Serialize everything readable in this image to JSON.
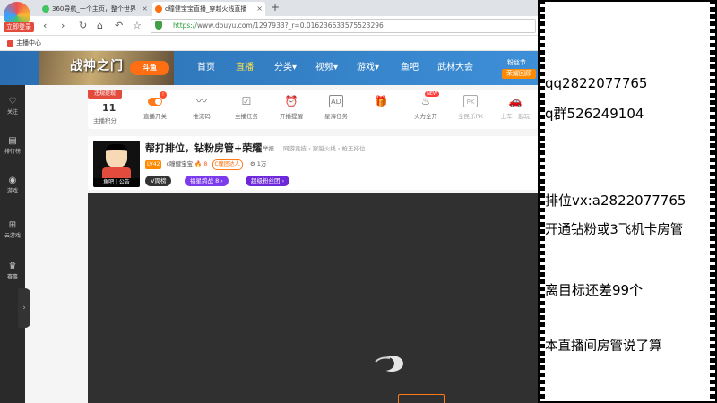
{
  "browser": {
    "tabs": [
      {
        "label": "360导航_一个主页，整个世界",
        "color": "#43c463"
      },
      {
        "label": "c瞳健宝宝直播_穿越火线直播",
        "color": "#ff6e13"
      }
    ],
    "new_tab": "+",
    "login_badge": "立即登录",
    "url_https": "https://",
    "url_rest": "www.douyu.com/1297933?_r=0.016236633575523296",
    "nav": {
      "back": "‹",
      "forward": "›",
      "reload": "↻",
      "home": "⌂",
      "undo": "↶",
      "star": "☆"
    },
    "bookmark": "主播中心"
  },
  "header": {
    "banner_text": "战神之门",
    "logo_text": "斗鱼",
    "nav_items": [
      "首页",
      "直播",
      "分类▾",
      "视频▾",
      "游戏▾",
      "鱼吧",
      "武林大会"
    ],
    "active_index": 1,
    "follow_label": "粉丝节",
    "honor_label": "荣耀回顾"
  },
  "sidebar": {
    "items": [
      {
        "icon": "♡",
        "label": "关注"
      },
      {
        "icon": "▤",
        "label": "排行榜"
      },
      {
        "icon": "◉",
        "label": "游戏"
      },
      {
        "icon": "⊞",
        "label": "云游戏"
      },
      {
        "icon": "♛",
        "label": "赛事"
      }
    ],
    "collapse_icon": "›"
  },
  "toolbar": {
    "badge": "违规提现",
    "score": "11",
    "score_label": "主播积分",
    "dot": "!",
    "new_badge": "NEW",
    "tools": [
      {
        "icon": "toggle",
        "label": "直播开关"
      },
      {
        "icon": "〰",
        "label": "推流码"
      },
      {
        "icon": "☑",
        "label": "主播任务"
      },
      {
        "icon": "⏰",
        "label": "开播提醒"
      },
      {
        "icon": "AD",
        "label": "星海任务"
      },
      {
        "icon": "🎁",
        "label": ""
      },
      {
        "icon": "♨",
        "label": "火力全开"
      },
      {
        "icon": "PK",
        "label": "全民乐PK"
      },
      {
        "icon": "🚗",
        "label": "上车一起玩"
      }
    ]
  },
  "room": {
    "title": "帮打排位，钻粉房管+荣耀",
    "report": "举报",
    "crumb": "网游竞技 › 穿越火线 › 枪王排位",
    "level": "LV42",
    "streamer": "c瞳健宝宝",
    "hot": "🔥 8",
    "fan_club": "C瞳团达人",
    "fans": "⚙ 1万",
    "avatar_caption": "鱼吧 | 公告",
    "pill1": "V周榜",
    "pill2": "福星鸽战 8 ›",
    "pill3": "超级粉丝团 ›"
  },
  "panel": {
    "lines": [
      "qq2822077765",
      "q群526249104",
      "排位vx:a2822077765",
      "开通钻粉或3飞机卡房管",
      "离目标还差99个",
      "本直播间房管说了算"
    ]
  }
}
